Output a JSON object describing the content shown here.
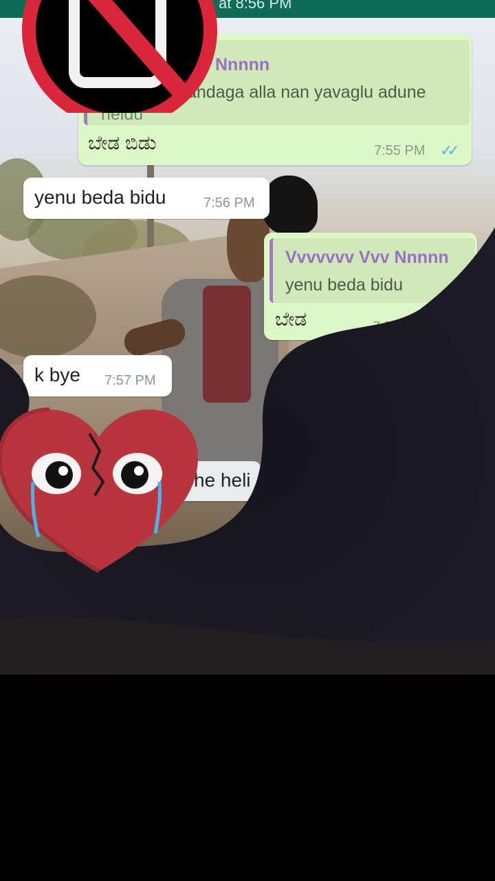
{
  "status_bar": {
    "text": "at 8:56 PM"
  },
  "messages": [
    {
      "quote_sender": "Nnnnn",
      "quote_text": "andaga alla nan yavaglu adune",
      "quote_text2": "heldu",
      "text": "ಬೇಡ ಬಿಡು",
      "time": "7:55 PM",
      "ticks": "✓✓"
    },
    {
      "text": "yenu beda bidu",
      "time": "7:56 PM"
    },
    {
      "quote_sender": "Vvvvvvv Vvv Nnnnn",
      "quote_text": "yenu beda bidu",
      "text": "ಬೇಡ",
      "time": "7:56 PM"
    },
    {
      "text": "k bye",
      "time": "7:57 PM"
    },
    {
      "text": "he heli"
    }
  ],
  "stickers": {
    "no_phone": "no-phone-sticker",
    "heart": "crying-broken-heart-sticker"
  },
  "colors": {
    "header": "#0e6b58",
    "outgoing_bubble": "#dcf8c6",
    "incoming_bubble": "#ffffff",
    "quote_sender": "#9b6fc2",
    "read_ticks": "#4fb6ec"
  }
}
